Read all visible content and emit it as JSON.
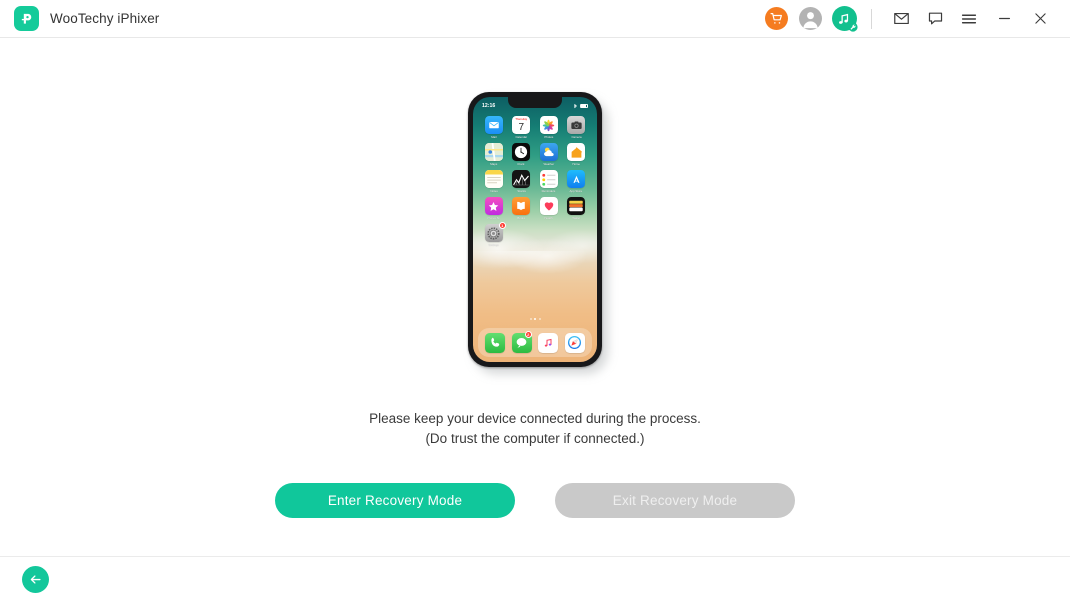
{
  "window": {
    "app_title": "WooTechy iPhixer",
    "logo_icon": "wootechy-p-logo-icon",
    "logo_color": "#15cb9a"
  },
  "toolbar": {
    "items": [
      {
        "name": "shop-cart-icon",
        "label": "Shop",
        "color": "#f57c20"
      },
      {
        "name": "account-icon",
        "label": "Account",
        "color": "#b3b3b3"
      },
      {
        "name": "audio-repair-icon",
        "label": "Audio Repair",
        "color": "#12c08e"
      },
      {
        "name": "mail-icon",
        "label": "Feedback Mail",
        "color": "#3c3c3c"
      },
      {
        "name": "chat-icon",
        "label": "Live Chat",
        "color": "#3c3c3c"
      },
      {
        "name": "menu-icon",
        "label": "Menu",
        "color": "#3c3c3c"
      },
      {
        "name": "minimize-icon",
        "label": "Minimize",
        "color": "#3c3c3c"
      },
      {
        "name": "close-icon",
        "label": "Close",
        "color": "#3c3c3c"
      }
    ]
  },
  "device": {
    "model": "iPhone X",
    "status_bar": {
      "time": "12:16"
    },
    "apps": [
      {
        "label": "Mail",
        "icon": "mail-app-icon"
      },
      {
        "label": "Calendar",
        "icon": "calendar-app-icon",
        "day": "7",
        "weekday": "Thursday"
      },
      {
        "label": "Photos",
        "icon": "photos-app-icon"
      },
      {
        "label": "Camera",
        "icon": "camera-app-icon"
      },
      {
        "label": "Maps",
        "icon": "maps-app-icon"
      },
      {
        "label": "Clock",
        "icon": "clock-app-icon"
      },
      {
        "label": "Weather",
        "icon": "weather-app-icon"
      },
      {
        "label": "Home",
        "icon": "home-app-icon"
      },
      {
        "label": "Notes",
        "icon": "notes-app-icon"
      },
      {
        "label": "Stocks",
        "icon": "stocks-app-icon"
      },
      {
        "label": "Reminders",
        "icon": "reminders-app-icon"
      },
      {
        "label": "App Store",
        "icon": "app-store-app-icon"
      },
      {
        "label": "iTunes St",
        "icon": "itunes-store-app-icon"
      },
      {
        "label": "Books",
        "icon": "books-app-icon"
      },
      {
        "label": "Health",
        "icon": "health-app-icon"
      },
      {
        "label": "Wallet",
        "icon": "wallet-app-icon"
      }
    ],
    "settings_app": {
      "label": "Settings",
      "icon": "settings-app-icon",
      "badge": "1"
    },
    "page_dots": {
      "count": 3,
      "active_index": 1
    },
    "dock": [
      {
        "label": "Phone",
        "icon": "phone-app-icon",
        "badge": ""
      },
      {
        "label": "Messages",
        "icon": "messages-app-icon",
        "badge": "2"
      },
      {
        "label": "Music",
        "icon": "music-app-icon",
        "badge": ""
      },
      {
        "label": "Safari",
        "icon": "safari-app-icon",
        "badge": ""
      }
    ]
  },
  "main": {
    "notice_line1": "Please keep your device connected during the process.",
    "notice_line2": "(Do trust the computer if connected.)",
    "enter_recovery_label": "Enter Recovery Mode",
    "exit_recovery_label": "Exit Recovery Mode",
    "enter_recovery_color": "#10c79b",
    "exit_recovery_color": "#c9c9c9"
  },
  "footer": {
    "back_icon": "back-arrow-icon",
    "back_color": "#13c79b"
  }
}
